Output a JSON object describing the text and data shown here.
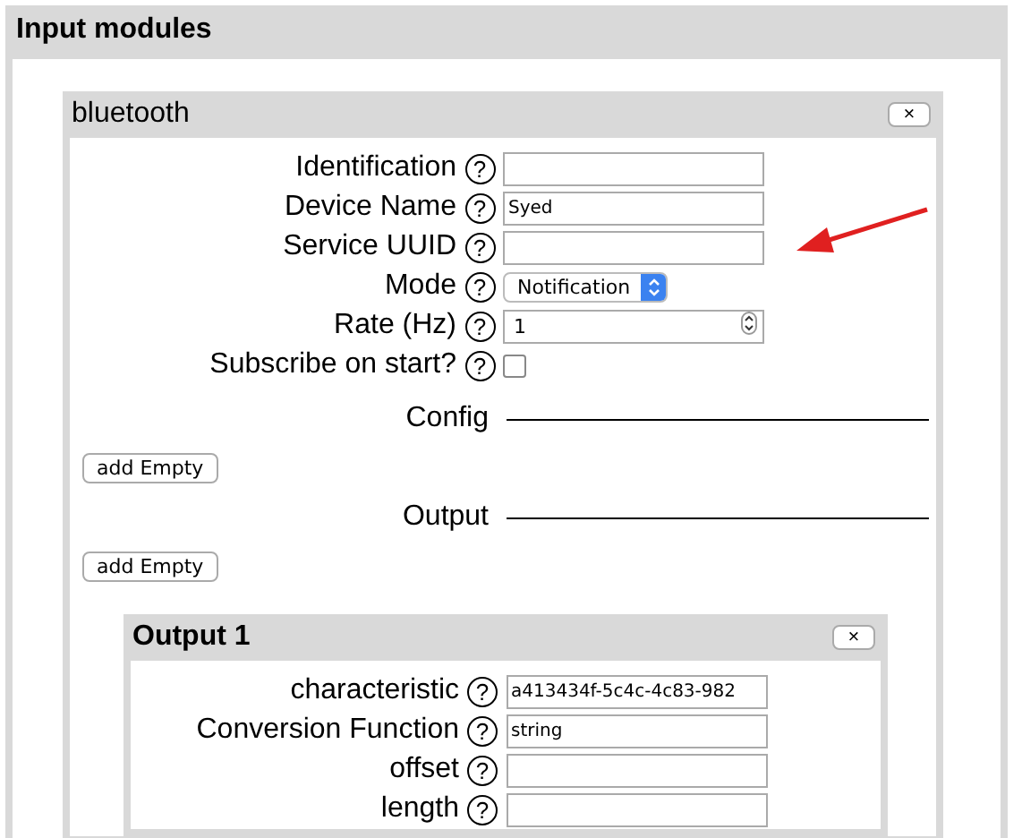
{
  "panel": {
    "title": "Input modules",
    "modules": [
      {
        "title": "bluetooth",
        "title_bold": false,
        "close": "×",
        "fields": [
          {
            "kind": "text",
            "label": "Identification",
            "help": "?"
          },
          {
            "kind": "text",
            "label": "Device Name",
            "help": "?",
            "value": "Syed"
          },
          {
            "kind": "text",
            "label": "Service UUID",
            "help": "?"
          },
          {
            "kind": "select",
            "label": "Mode",
            "help": "?",
            "value": "Notification"
          },
          {
            "kind": "number",
            "label": "Rate (Hz)",
            "help": "?",
            "value": "1"
          },
          {
            "kind": "checkbox",
            "label": "Subscribe on start?",
            "help": "?",
            "checked": false
          }
        ],
        "sections": [
          {
            "title": "Config",
            "button": "add Empty"
          },
          {
            "title": "Output",
            "button": "add Empty",
            "children": [
              {
                "title": "Output 1",
                "title_bold": true,
                "close": "×",
                "fields": [
                  {
                    "kind": "text",
                    "label": "characteristic",
                    "help": "?",
                    "value": "a413434f-5c4c-4c83-982"
                  },
                  {
                    "kind": "text",
                    "label": "Conversion Function",
                    "help": "?",
                    "value": "string"
                  },
                  {
                    "kind": "text",
                    "label": "offset",
                    "help": "?"
                  },
                  {
                    "kind": "text",
                    "label": "length",
                    "help": "?"
                  }
                ]
              }
            ]
          }
        ]
      }
    ]
  }
}
